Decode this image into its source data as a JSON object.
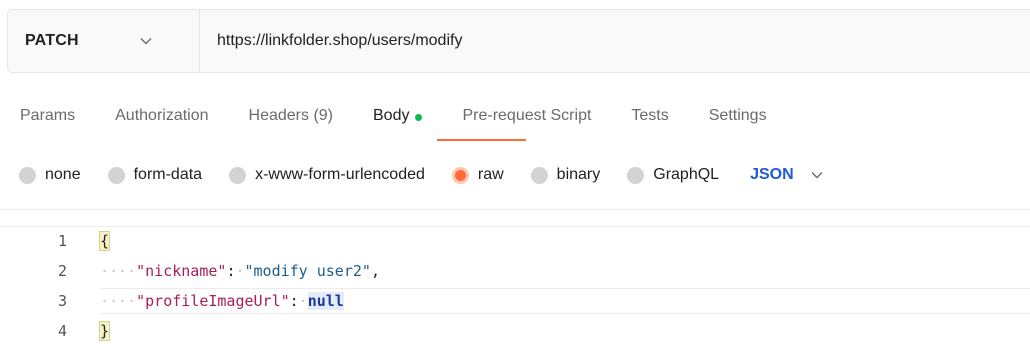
{
  "request": {
    "method": "PATCH",
    "url": "https://linkfolder.shop/users/modify"
  },
  "tabs": [
    {
      "label": "Params",
      "active": false
    },
    {
      "label": "Authorization",
      "active": false
    },
    {
      "label": "Headers (9)",
      "active": false
    },
    {
      "label": "Body",
      "active": true
    },
    {
      "label": "Pre-request Script",
      "active": false
    },
    {
      "label": "Tests",
      "active": false
    },
    {
      "label": "Settings",
      "active": false
    }
  ],
  "body_types": [
    {
      "label": "none",
      "selected": false
    },
    {
      "label": "form-data",
      "selected": false
    },
    {
      "label": "x-www-form-urlencoded",
      "selected": false
    },
    {
      "label": "raw",
      "selected": true
    },
    {
      "label": "binary",
      "selected": false
    },
    {
      "label": "GraphQL",
      "selected": false
    }
  ],
  "language": "JSON",
  "editor": {
    "lines": [
      {
        "number": "1",
        "open_brace": "{"
      },
      {
        "number": "2",
        "key": "\"nickname\"",
        "colon": ":",
        "value": "\"modify user2\"",
        "comma": ","
      },
      {
        "number": "3",
        "key": "\"profileImageUrl\"",
        "colon": ":",
        "value": "null"
      },
      {
        "number": "4",
        "close_brace": "}"
      }
    ]
  },
  "colors": {
    "accent": "#ff6c37",
    "active_dot": "#0cbb52",
    "language": "#1e5bd8"
  }
}
